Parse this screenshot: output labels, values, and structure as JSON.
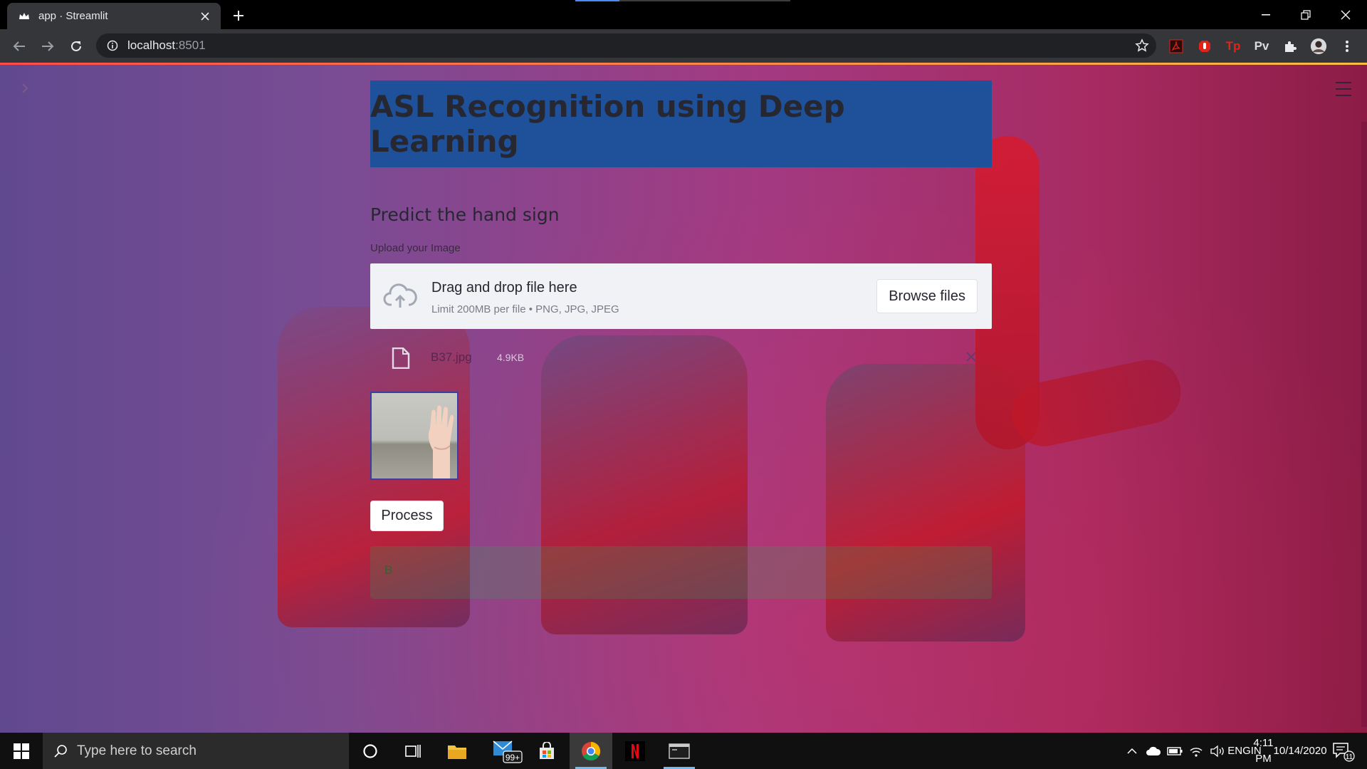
{
  "browser": {
    "tab": {
      "title": "app · Streamlit",
      "favicon": "streamlit-crown-icon"
    },
    "url": {
      "host": "localhost",
      "port": ":8501"
    },
    "extensions": [
      {
        "name": "pdf-extension-icon",
        "color": "#e2231a"
      },
      {
        "name": "adblock-hand-icon",
        "color": "#e2231a"
      },
      {
        "name": "tp-extension",
        "label": "Tp",
        "color": "#e2231a"
      },
      {
        "name": "pv-extension",
        "label": "Pv",
        "color": "#dadce0"
      },
      {
        "name": "puzzle-extensions-icon"
      },
      {
        "name": "profile-avatar"
      }
    ]
  },
  "app": {
    "title": "ASL Recognition using Deep Learning",
    "subheader": "Predict the hand sign",
    "uploader": {
      "label": "Upload your Image",
      "drop_text": "Drag and drop file here",
      "limit_text": "Limit 200MB per file • PNG, JPG, JPEG",
      "browse_label": "Browse files",
      "file_name": "B37.jpg",
      "file_size": "4.9KB"
    },
    "process_label": "Process",
    "result": "B"
  },
  "taskbar": {
    "search_placeholder": "Type here to search",
    "store_badge": "99+",
    "language": {
      "line1": "ENG",
      "line2": "IN"
    },
    "time": "4:11 PM",
    "date": "10/14/2020",
    "notifications": "11"
  },
  "colors": {
    "header_bg": "#1e5199",
    "accent_gradient": [
      "#ff4b4b",
      "#ffbd45"
    ],
    "success_bg": "rgba(40,170,80,0.22)"
  }
}
